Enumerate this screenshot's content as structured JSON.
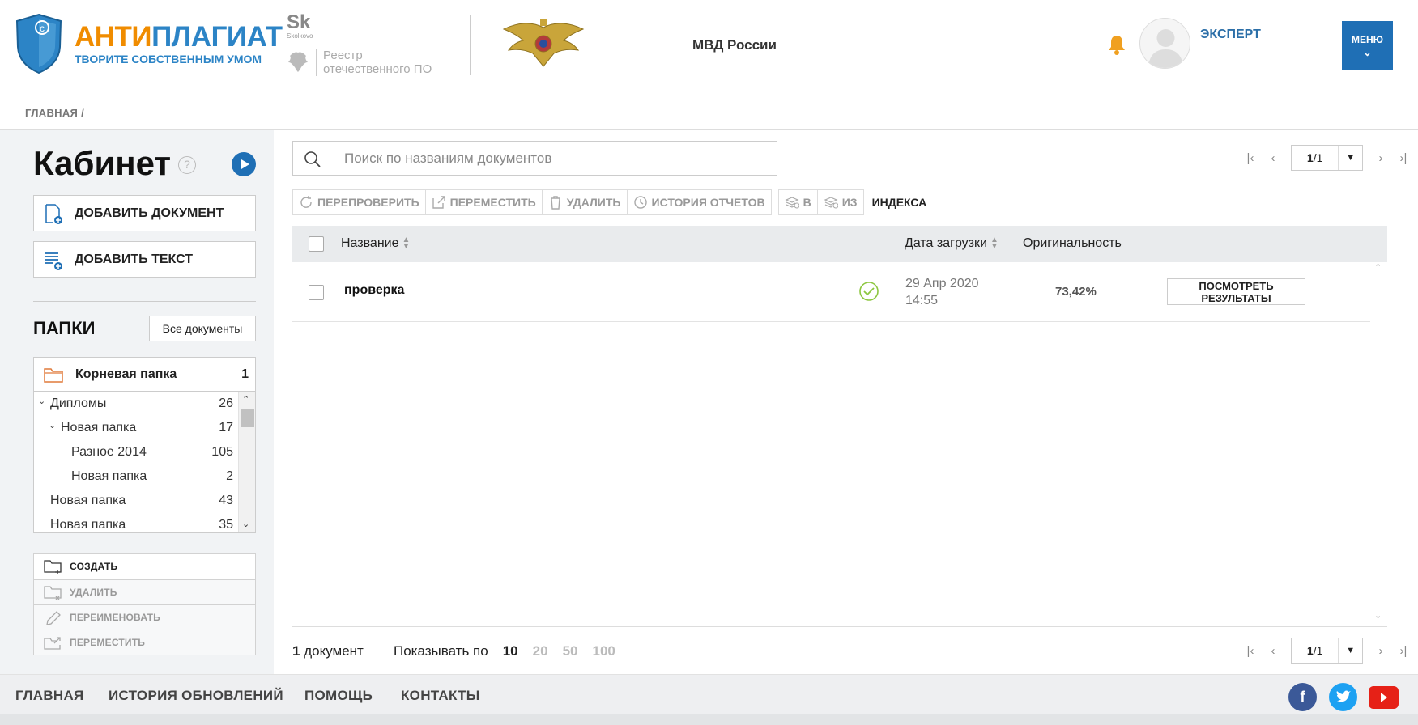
{
  "header": {
    "logo_anti": "АНТИ",
    "logo_plagiat": "ПЛАГИАТ",
    "logo_tagline": "ТВОРИТЕ СОБСТВЕННЫМ УМОМ",
    "skolkovo_mark": "Sk",
    "skolkovo_small": "Skolkovo",
    "registry_line1": "Реестр",
    "registry_line2": "отечественного ПО",
    "organization": "МВД России",
    "user_name": "ЭКСПЕРТ",
    "menu_label": "МЕНЮ"
  },
  "breadcrumb": "ГЛАВНАЯ /",
  "sidebar": {
    "title": "Кабинет",
    "help_glyph": "?",
    "add_document": "ДОБАВИТЬ ДОКУМЕНТ",
    "add_text": "ДОБАВИТЬ ТЕКСТ",
    "folders_title": "ПАПКИ",
    "all_documents": "Все документы",
    "root_folder": {
      "label": "Корневая папка",
      "count": "1"
    },
    "tree": [
      {
        "label": "Дипломы",
        "count": "26"
      },
      {
        "label": "Новая папка",
        "count": "17"
      },
      {
        "label": "Разное 2014",
        "count": "105"
      },
      {
        "label": "Новая папка",
        "count": "2"
      },
      {
        "label": "Новая папка",
        "count": "43"
      },
      {
        "label": "Новая папка",
        "count": "35"
      }
    ],
    "folder_actions": {
      "create": "СОЗДАТЬ",
      "delete": "УДАЛИТЬ",
      "rename": "ПЕРЕИМЕНОВАТЬ",
      "move": "ПЕРЕМЕСТИТЬ"
    }
  },
  "search": {
    "placeholder": "Поиск по названиям документов"
  },
  "pager": {
    "current": "1",
    "total": "/1"
  },
  "toolbar": {
    "recheck": "ПЕРЕПРОВЕРИТЬ",
    "move": "ПЕРЕМЕСТИТЬ",
    "delete": "УДАЛИТЬ",
    "history": "ИСТОРИЯ ОТЧЕТОВ",
    "to": "В",
    "from": "ИЗ",
    "index": "ИНДЕКСА"
  },
  "table": {
    "columns": {
      "name": "Название",
      "date": "Дата загрузки",
      "originality": "Оригинальность"
    },
    "rows": [
      {
        "name": "проверка",
        "date_line1": "29 Апр 2020",
        "date_line2": "14:55",
        "originality": "73,42%",
        "action": "ПОСМОТРЕТЬ РЕЗУЛЬТАТЫ"
      }
    ]
  },
  "bottom": {
    "doc_count_num": "1",
    "doc_count_label": " документ",
    "per_page_label": "Показывать по",
    "per_page_options": [
      "10",
      "20",
      "50",
      "100"
    ],
    "per_page_selected": "10"
  },
  "footer": {
    "links": [
      "ГЛАВНАЯ",
      "ИСТОРИЯ ОБНОВЛЕНИЙ",
      "ПОМОЩЬ",
      "КОНТАКТЫ"
    ]
  },
  "colors": {
    "brand_blue": "#1f6fb5",
    "brand_orange": "#f08c00",
    "facebook": "#3b5998",
    "twitter": "#1da1f2",
    "youtube": "#e62117"
  }
}
